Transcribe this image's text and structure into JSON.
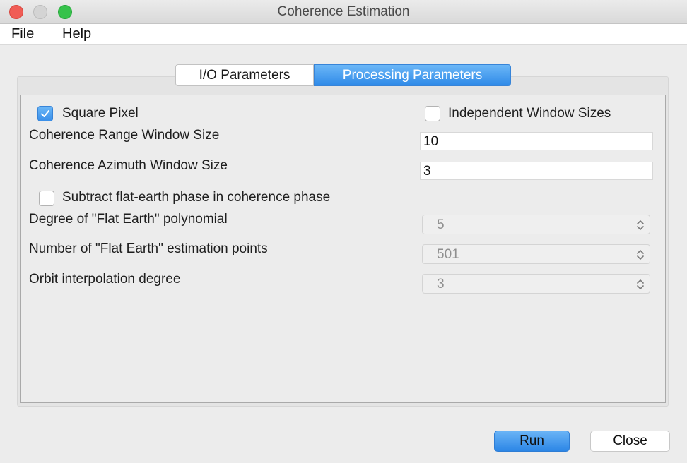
{
  "window": {
    "title": "Coherence Estimation"
  },
  "menu": {
    "file": "File",
    "help": "Help"
  },
  "tabs": [
    {
      "label": "I/O Parameters",
      "selected": false
    },
    {
      "label": "Processing Parameters",
      "selected": true
    }
  ],
  "form": {
    "square_pixel": {
      "label": "Square Pixel",
      "checked": true
    },
    "independent_window_sizes": {
      "label": "Independent Window Sizes",
      "checked": false
    },
    "range_window": {
      "label": "Coherence Range Window Size",
      "value": "10"
    },
    "azimuth_window": {
      "label": "Coherence Azimuth Window Size",
      "value": "3"
    },
    "subtract_flat_earth": {
      "label": "Subtract flat-earth phase in coherence phase",
      "checked": false
    },
    "flat_earth_degree": {
      "label": "Degree of \"Flat Earth\" polynomial",
      "value": "5"
    },
    "flat_earth_points": {
      "label": "Number of \"Flat Earth\" estimation points",
      "value": "501"
    },
    "orbit_degree": {
      "label": "Orbit interpolation degree",
      "value": "3"
    }
  },
  "buttons": {
    "run": "Run",
    "close": "Close"
  },
  "colors": {
    "accent": "#3a8fe9",
    "disabled_text": "#8f8f8f"
  },
  "icons": [
    "checkmark-icon",
    "up-down-arrows-icon"
  ]
}
